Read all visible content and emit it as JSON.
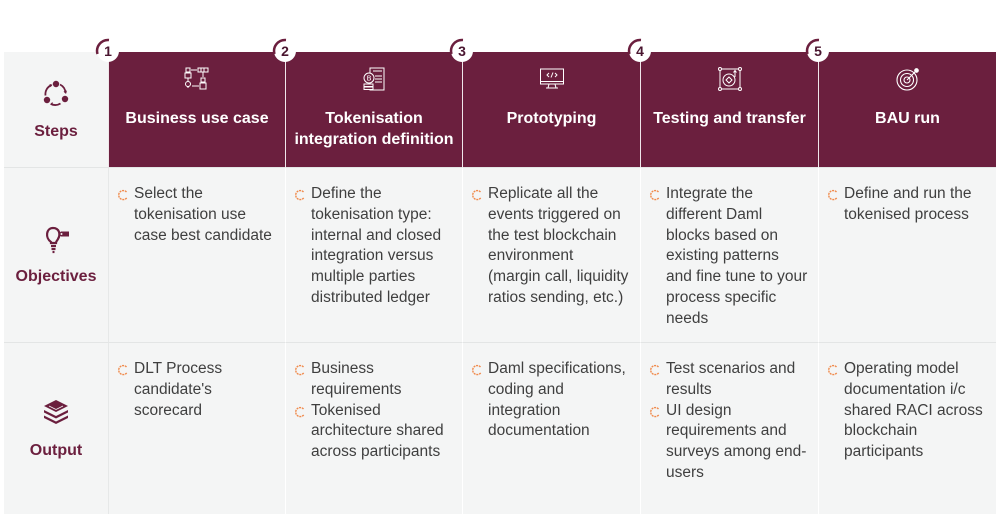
{
  "colors": {
    "brand": "#6b1f3e",
    "cell_background": "#f4f5f5",
    "bullet": "#f08a4b",
    "text": "#3f3f3f"
  },
  "row_labels": {
    "steps": {
      "label": "Steps",
      "icon": "cycle-arrows-icon"
    },
    "objectives": {
      "label": "Objectives",
      "icon": "lightbulb-tag-icon"
    },
    "output": {
      "label": "Output",
      "icon": "stacked-layers-icon"
    }
  },
  "steps": [
    {
      "number": "1",
      "title": "Business use case",
      "icon": "process-flow-icon",
      "objectives": [
        "Select the tokenisation use case best candidate"
      ],
      "output": [
        "DLT Process candidate's scorecard"
      ]
    },
    {
      "number": "2",
      "title": "Tokenisation integration definition",
      "icon": "bitcoin-document-icon",
      "objectives": [
        "Define the tokenisation type: internal and closed integration versus multiple parties distributed ledger"
      ],
      "output": [
        "Business requirements",
        "Tokenised architecture shared across participants"
      ]
    },
    {
      "number": "3",
      "title": "Prototyping",
      "icon": "monitor-code-icon",
      "objectives": [
        "Replicate all the events triggered on the test blockchain environment (margin call, liquidity ratios sending, etc.)"
      ],
      "output": [
        "Daml specifications, coding and integration documentation"
      ]
    },
    {
      "number": "4",
      "title": "Testing and transfer",
      "icon": "target-frame-icon",
      "objectives": [
        "Integrate the different Daml blocks based on existing patterns and fine tune to your process specific needs"
      ],
      "output": [
        "Test scenarios and results",
        "UI design requirements and surveys among end-users"
      ]
    },
    {
      "number": "5",
      "title": "BAU run",
      "icon": "bullseye-icon",
      "objectives": [
        "Define and run the tokenised process"
      ],
      "output": [
        "Operating model documentation i/c shared RACI across blockchain participants"
      ]
    }
  ]
}
